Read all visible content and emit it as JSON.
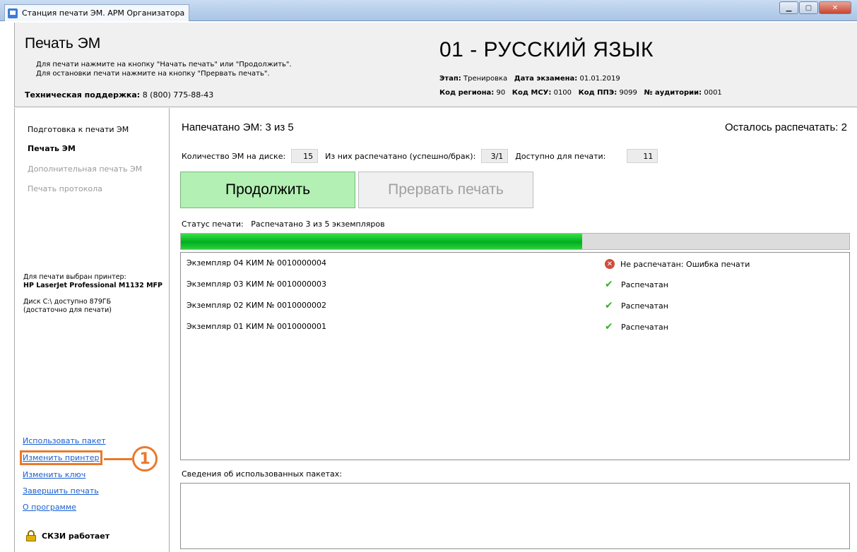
{
  "window": {
    "title": "Станция печати ЭМ. АРМ Организатора",
    "min_glyph": "▁",
    "max_glyph": "▢",
    "close_glyph": "✕"
  },
  "header": {
    "title": "Печать ЭМ",
    "hint_line1": "Для печати нажмите на кнопку \"Начать печать\" или \"Продолжить\".",
    "hint_line2": "Для остановки печати нажмите на кнопку \"Прервать печать\".",
    "support_label": "Техническая поддержка:",
    "support_phone": "8 (800) 775-88-43",
    "subject": "01 - РУССКИЙ ЯЗЫК",
    "stage_label": "Этап:",
    "stage_value": "Тренировка",
    "exam_date_label": "Дата экзамена:",
    "exam_date_value": "01.01.2019",
    "region_label": "Код региона:",
    "region_value": "90",
    "msu_label": "Код МСУ:",
    "msu_value": "0100",
    "ppe_label": "Код ППЭ:",
    "ppe_value": "9099",
    "room_label": "№ аудитории:",
    "room_value": "0001"
  },
  "sidebar": {
    "nav": [
      {
        "label": "Подготовка к печати ЭМ",
        "state": "normal"
      },
      {
        "label": "Печать ЭМ",
        "state": "active"
      },
      {
        "label": "Дополнительная печать ЭМ",
        "state": "disabled"
      },
      {
        "label": "Печать протокола",
        "state": "disabled"
      }
    ],
    "printer_label": "Для печати выбран принтер:",
    "printer_name": "HP LaserJet Professional M1132 MFP",
    "disk_line1": "Диск C:\\ доступно 879ГБ",
    "disk_line2": "(достаточно для печати)",
    "links": [
      "Использовать пакет",
      "Изменить принтер",
      "Изменить ключ",
      "Завершить печать",
      "О программе"
    ],
    "annotation_number": "1",
    "skzi_status": "СКЗИ работает"
  },
  "main": {
    "printed_label": "Напечатано ЭМ:",
    "printed_count": "3",
    "printed_of": "из",
    "printed_total": "5",
    "remaining_label": "Осталось распечатать:",
    "remaining_value": "2",
    "disk_count_label": "Количество ЭМ на диске:",
    "disk_count_value": "15",
    "printed_ok_label": "Из них распечатано (успешно/брак):",
    "printed_ok_value": "3/1",
    "available_label": "Доступно для печати:",
    "available_value": "11",
    "continue_button": "Продолжить",
    "abort_button": "Прервать печать",
    "status_label": "Статус печати:",
    "status_value": "Распечатано 3 из 5 экземпляров",
    "progress": 0.6,
    "copies": [
      {
        "name": "Экземпляр 04  КИМ № 0010000004",
        "status": "Не распечатан: Ошибка печати",
        "icon": "error-icon"
      },
      {
        "name": "Экземпляр 03  КИМ № 0010000003",
        "status": "Распечатан",
        "icon": "check-icon"
      },
      {
        "name": "Экземпляр 02  КИМ № 0010000002",
        "status": "Распечатан",
        "icon": "check-icon"
      },
      {
        "name": "Экземпляр 01  КИМ № 0010000001",
        "status": "Распечатан",
        "icon": "check-icon"
      }
    ],
    "error_glyph": "✕",
    "check_glyph": "✔",
    "packages_label": "Сведения об использованных пакетах:"
  },
  "colors": {
    "accent_annotation": "#e9792e",
    "continue_bg": "#b3f0b3",
    "progress_green": "#00b020",
    "link_blue": "#1a5fd0"
  }
}
